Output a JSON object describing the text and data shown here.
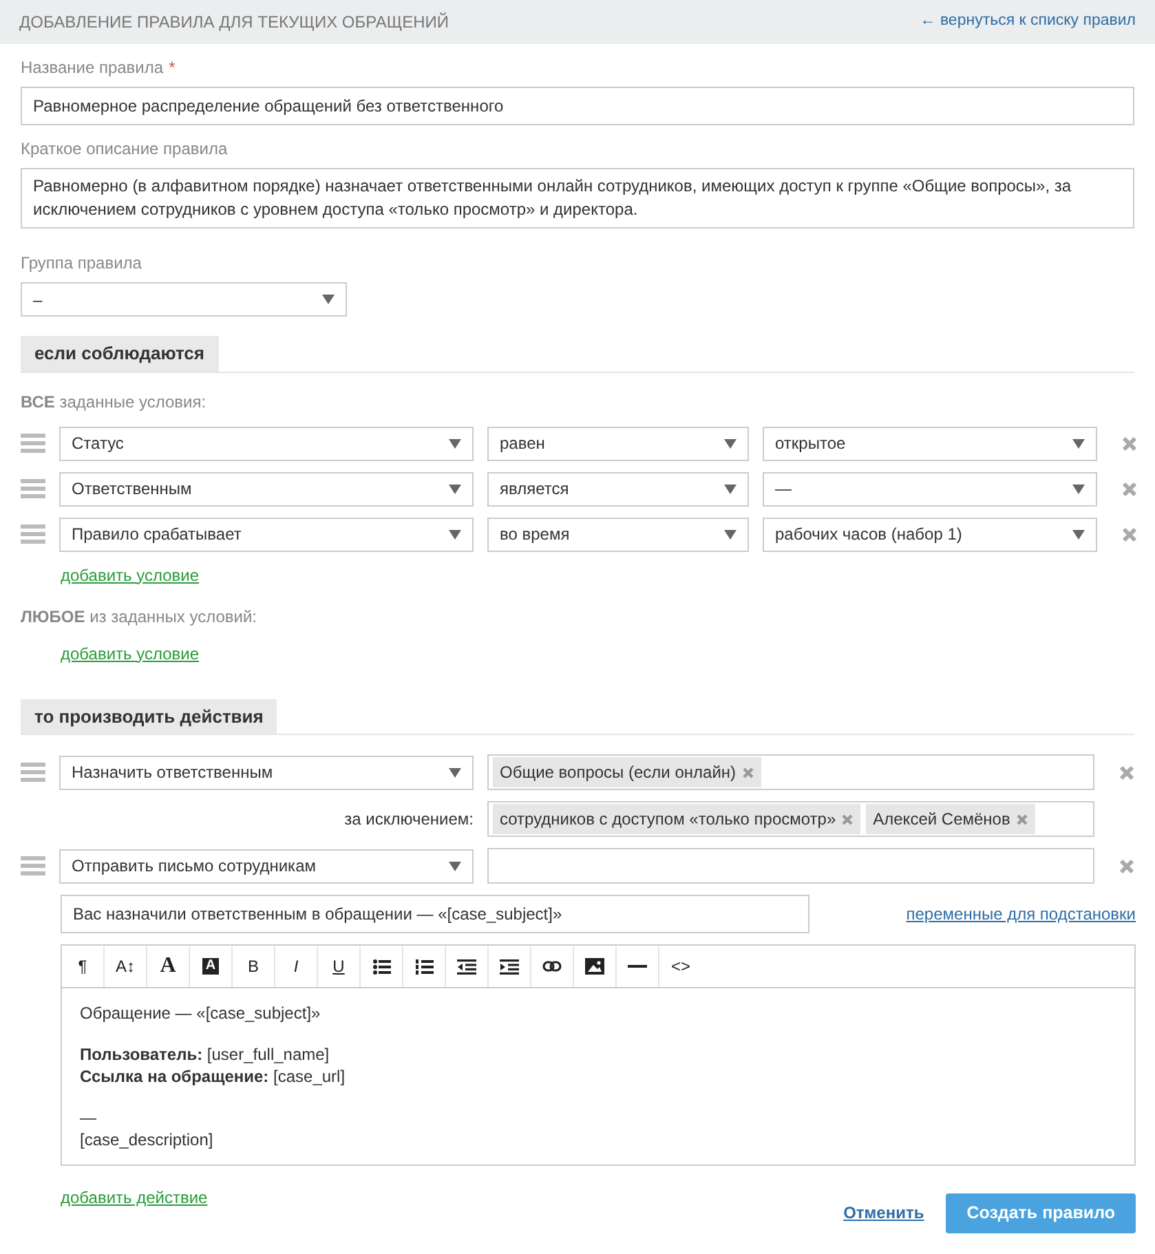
{
  "header": {
    "title": "ДОБАВЛЕНИЕ ПРАВИЛА ДЛЯ ТЕКУЩИХ ОБРАЩЕНИЙ",
    "back_link": "← вернуться к списку правил"
  },
  "name_field": {
    "label": "Название правила",
    "required_mark": "*",
    "value": "Равномерное распределение обращений без ответственного"
  },
  "description_field": {
    "label": "Краткое описание правила",
    "value": "Равномерно (в алфавитном порядке) назначает ответственными онлайн сотрудников, имеющих доступ к группе «Общие вопросы», за исключением сотрудников с уровнем доступа «только просмотр» и директора."
  },
  "group_field": {
    "label": "Группа правила",
    "value": "–"
  },
  "conditions_section": {
    "title": "если соблюдаются",
    "all_label": "**ВСЕ** заданные условия:",
    "all_conditions": [
      {
        "field": "Статус",
        "operator": "равен",
        "value": "открытое"
      },
      {
        "field": "Ответственным",
        "operator": "является",
        "value": "—"
      },
      {
        "field": "Правило срабатывает",
        "operator": "во время",
        "value": "рабочих часов (набор 1)"
      }
    ],
    "all_add_link": "добавить условие",
    "any_label": "**ЛЮБОЕ** из заданных условий:",
    "any_add_link": "добавить условие"
  },
  "actions_section": {
    "title": "то производить действия",
    "actions": [
      {
        "kind": "assign",
        "action": "Назначить ответственным",
        "tags": [
          "Общие вопросы (если онлайн)"
        ],
        "except_label": "за исключением:",
        "except_tags": [
          "сотрудников с доступом «только просмотр»",
          "Алексей Семёнов"
        ]
      },
      {
        "kind": "email",
        "action": "Отправить письмо сотрудникам",
        "subject": "Вас назначили ответственным в обращении — «[case_subject]»",
        "variables_link": "переменные для подстановки",
        "toolbar": [
          {
            "kind": "glyph",
            "glyph": "¶"
          },
          {
            "kind": "glyph",
            "glyph": "A↕"
          },
          {
            "kind": "serif",
            "glyph": "A"
          },
          {
            "kind": "inverse",
            "glyph": "A"
          },
          {
            "kind": "glyph",
            "glyph": "B"
          },
          {
            "kind": "italic",
            "glyph": "I"
          },
          {
            "kind": "underline",
            "glyph": "U"
          },
          {
            "kind": "bullet-list"
          },
          {
            "kind": "number-list"
          },
          {
            "kind": "outdent"
          },
          {
            "kind": "indent"
          },
          {
            "kind": "link"
          },
          {
            "kind": "image"
          },
          {
            "kind": "rule"
          },
          {
            "kind": "glyph",
            "glyph": "<>"
          }
        ],
        "body": [
          [
            "Обращение — «[case_subject]»"
          ],
          [
            "**Пользователь:** [user_full_name]",
            "**Ссылка на обращение:** [case_url]"
          ],
          [
            "—",
            "[case_description]"
          ]
        ]
      }
    ],
    "add_action_link": "добавить действие"
  },
  "footer": {
    "cancel": "Отменить",
    "submit": "Создать правило"
  }
}
